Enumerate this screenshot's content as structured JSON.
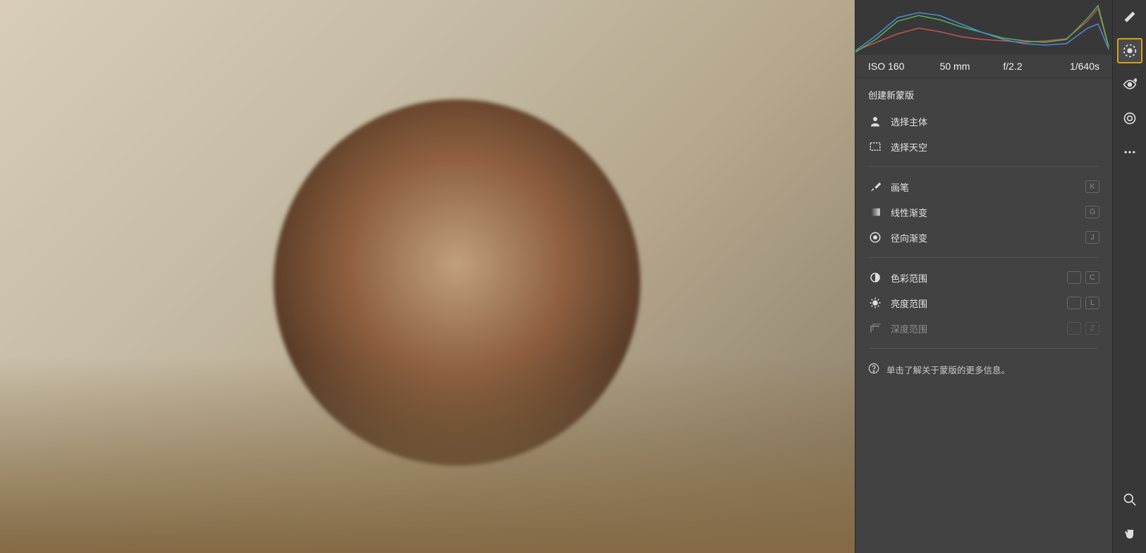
{
  "exif": {
    "iso": "ISO 160",
    "focal": "50 mm",
    "aperture": "f/2.2",
    "shutter": "1/640s"
  },
  "panel": {
    "section_title": "创建新蒙版",
    "select_subject": "选择主体",
    "select_sky": "选择天空",
    "brush": "画笔",
    "linear_gradient": "线性渐变",
    "radial_gradient": "径向渐变",
    "color_range": "色彩范围",
    "luminance_range": "亮度范围",
    "depth_range": "深度范围",
    "help_text": "单击了解关于蒙版的更多信息。",
    "kbd": {
      "brush": "K",
      "linear": "G",
      "radial": "J",
      "color": "C",
      "lum": "L",
      "depth": "Z",
      "alt": " "
    }
  },
  "tools": {
    "edit": "edit-tool",
    "mask": "mask-tool",
    "crop": "crop-tool",
    "redeye": "redeye-tool",
    "more": "more-tool",
    "zoom": "zoom-tool",
    "hand": "hand-tool"
  }
}
